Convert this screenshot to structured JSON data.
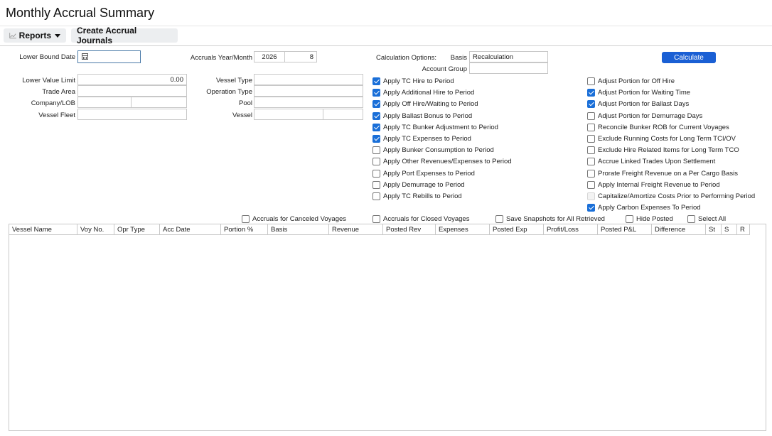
{
  "page": {
    "title": "Monthly Accrual Summary"
  },
  "toolbar": {
    "reports_label": "Reports",
    "create_label": "Create Accrual Journals"
  },
  "form": {
    "lower_bound_date": {
      "label": "Lower Bound Date",
      "value": ""
    },
    "accruals_year_month": {
      "label": "Accruals Year/Month",
      "year": "2026",
      "month": "8"
    },
    "lower_value_limit": {
      "label": "Lower Value Limit",
      "value": "0.00"
    },
    "trade_area": {
      "label": "Trade Area",
      "value": ""
    },
    "company_lob": {
      "label": "Company/LOB",
      "value1": "",
      "value2": ""
    },
    "vessel_fleet": {
      "label": "Vessel Fleet",
      "value": ""
    },
    "vessel_type": {
      "label": "Vessel Type",
      "value": ""
    },
    "operation_type": {
      "label": "Operation Type",
      "value": ""
    },
    "pool": {
      "label": "Pool",
      "value": ""
    },
    "vessel": {
      "label": "Vessel",
      "value1": "",
      "value2": ""
    },
    "calculation_options_label": "Calculation Options:",
    "basis": {
      "label": "Basis",
      "value": "Recalculation"
    },
    "account_group": {
      "label": "Account Group",
      "value": ""
    }
  },
  "calculate_label": "Calculate",
  "options_left": [
    {
      "label": "Apply TC Hire to Period",
      "checked": true
    },
    {
      "label": "Apply Additional Hire to Period",
      "checked": true
    },
    {
      "label": "Apply Off Hire/Waiting to Period",
      "checked": true
    },
    {
      "label": "Apply Ballast Bonus to Period",
      "checked": true
    },
    {
      "label": "Apply TC Bunker Adjustment to Period",
      "checked": true
    },
    {
      "label": "Apply TC Expenses to Period",
      "checked": true
    },
    {
      "label": "Apply Bunker Consumption to Period",
      "checked": false
    },
    {
      "label": "Apply Other Revenues/Expenses to Period",
      "checked": false
    },
    {
      "label": "Apply Port Expenses to Period",
      "checked": false
    },
    {
      "label": "Apply Demurrage to Period",
      "checked": false
    },
    {
      "label": "Apply TC Rebills to Period",
      "checked": false
    }
  ],
  "options_right": [
    {
      "label": "Adjust Portion for Off Hire",
      "checked": false
    },
    {
      "label": "Adjust Portion for Waiting Time",
      "checked": true
    },
    {
      "label": "Adjust Portion for Ballast Days",
      "checked": true
    },
    {
      "label": "Adjust Portion for Demurrage Days",
      "checked": false
    },
    {
      "label": "Reconcile Bunker ROB for Current Voyages",
      "checked": false
    },
    {
      "label": "Exclude Running Costs for Long Term TCI/OV",
      "checked": false
    },
    {
      "label": "Exclude Hire Related Items for Long Term TCO",
      "checked": false
    },
    {
      "label": "Accrue Linked Trades Upon Settlement",
      "checked": false
    },
    {
      "label": "Prorate Freight Revenue on a Per Cargo Basis",
      "checked": false
    },
    {
      "label": "Apply Internal Freight Revenue to Period",
      "checked": false
    },
    {
      "label": "Capitalize/Amortize Costs Prior to Performing Period",
      "checked": false,
      "disabled": true
    },
    {
      "label": "Apply Carbon Expenses To Period",
      "checked": true
    }
  ],
  "filters": [
    {
      "label": "Accruals for Canceled Voyages",
      "checked": false
    },
    {
      "label": "Accruals for Closed Voyages",
      "checked": false
    },
    {
      "label": "Save Snapshots for All Retrieved",
      "checked": false
    },
    {
      "label": "Hide Posted",
      "checked": false
    },
    {
      "label": "Select All",
      "checked": false
    }
  ],
  "grid": {
    "columns": [
      "Vessel Name",
      "Voy No.",
      "Opr Type",
      "Acc Date",
      "Portion %",
      "Basis",
      "Revenue",
      "Posted Rev",
      "Expenses",
      "Posted Exp",
      "Profit/Loss",
      "Posted P&L",
      "Difference",
      "St",
      "S",
      "R"
    ],
    "rows": []
  }
}
